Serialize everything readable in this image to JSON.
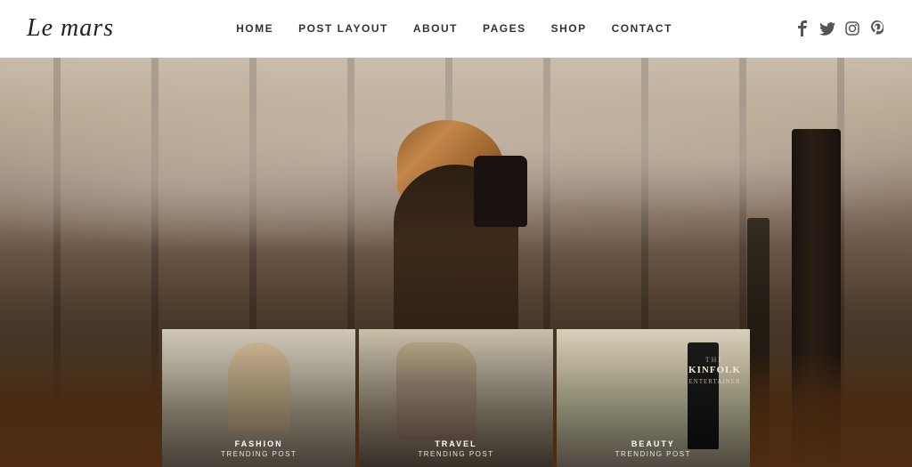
{
  "header": {
    "logo": "Le mars",
    "nav": {
      "home": "HOME",
      "post_layout": "POST LAYOUT",
      "about": "ABOUT",
      "pages": "PAGES",
      "shop": "SHOP",
      "contact": "CONTACT"
    },
    "social": {
      "facebook": "f",
      "twitter": "t",
      "instagram": "i",
      "pinterest": "p"
    }
  },
  "hero": {
    "alt": "Person sitting in foggy forest"
  },
  "cards": [
    {
      "category": "FASHION",
      "subtitle": "TRENDING POST"
    },
    {
      "category": "TRAVEL",
      "subtitle": "TRENDING POST"
    },
    {
      "category": "BEAUTY",
      "subtitle": "TRENDING POST"
    }
  ],
  "book": {
    "prefix": "THE",
    "title": "KINFOLK",
    "suffix": "ENTERTAINER"
  }
}
